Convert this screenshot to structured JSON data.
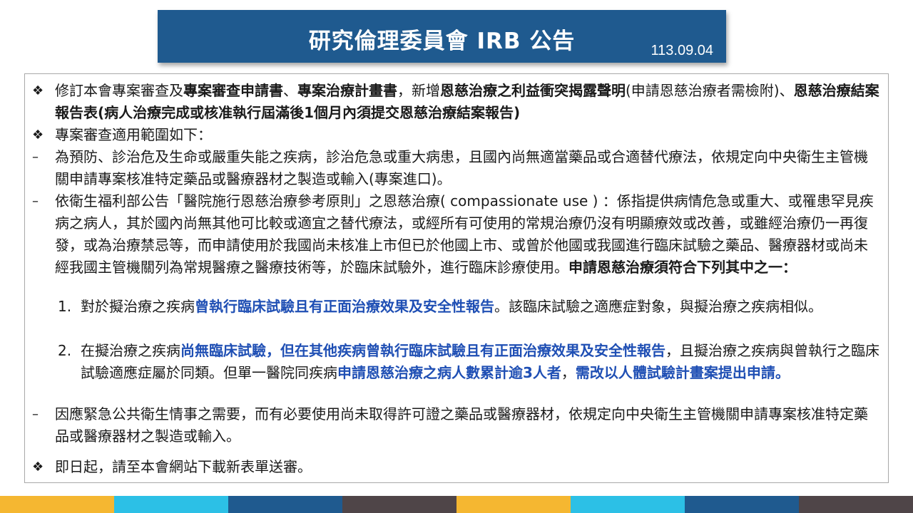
{
  "header": {
    "title": "研究倫理委員會 IRB 公告",
    "date": "113.09.04"
  },
  "colors": {
    "title_bg": "#1f5a8f",
    "highlight_blue": "#1f4fb4",
    "stripes": [
      "#f5b731",
      "#2cc0e6",
      "#1f5a8f",
      "#4f4548",
      "#f5b731",
      "#2cc0e6",
      "#1f5a8f",
      "#4f4548"
    ]
  },
  "icons": {
    "bullet": "diamond-bullet-icon"
  },
  "items": {
    "i1": {
      "marker": "❖",
      "p1": "修訂本會專案審查及",
      "b1": "專案審查申請書",
      "p2": "、",
      "b2": "專案治療計畫書",
      "p3": "，新增",
      "b3": "恩慈治療之利益衝突揭露聲明",
      "p4": "(申請恩慈治療者需檢附)、",
      "b4": "恩慈治療結案報告表(病人治療完成或核准執行屆滿後1個月內須提交恩慈治療結案報告)"
    },
    "i2": {
      "marker": "❖",
      "text": "專案審查適用範圍如下："
    },
    "i3": {
      "marker": "–",
      "text": "為預防、診治危及生命或嚴重失能之疾病，診治危急或重大病患，且國內尚無適當藥品或合適替代療法，依規定向中央衛生主管機關申請專案核准特定藥品或醫療器材之製造或輸入(專案進口)。"
    },
    "i4": {
      "marker": "–",
      "text": "依衛生福利部公告「醫院施行恩慈治療參考原則」之恩慈治療( compassionate use ) ：係指提供病情危急或重大、或罹患罕見疾病之病人，其於國內尚無其他可比較或適宜之替代療法，或經所有可使用的常規治療仍沒有明顯療效或改善，或雖經治療仍一再復發，或為治療禁忌等，而申請使用於我國尚未核准上市但已於他國上市、或曾於他國或我國進行臨床試驗之藥品、醫療器材或尚未經我國主管機關列為常規醫療之醫療技術等，於臨床試驗外，進行臨床診療使用。",
      "bold": "申請恩慈治療須符合下列其中之一："
    },
    "s1": {
      "marker": "1.",
      "p1": "對於擬治療之疾病",
      "blue1": "曾執行臨床試驗且有正面治療效果及安全性報告",
      "p2": "。該臨床試驗之適應症對象，與擬治療之疾病相似。"
    },
    "s2": {
      "marker": "2.",
      "p1": "在擬治療之疾病",
      "blue1": "尚無臨床試驗，但在其他疾病曾執行臨床試驗且有正面治療效果及安全性報告",
      "p2": "，且擬治療之疾病與曾執行之臨床試驗適應症屬於同類。但單一醫院同疾病",
      "blue2": "申請恩慈治療之病人數累計逾3人者",
      "p3": "，",
      "blue3": "需改以人體試驗計畫案提出申請。"
    },
    "i5": {
      "marker": "–",
      "text": "因應緊急公共衛生情事之需要，而有必要使用尚未取得許可證之藥品或醫療器材，依規定向中央衛生主管機關申請專案核准特定藥品或醫療器材之製造或輸入。"
    },
    "i6": {
      "marker": "❖",
      "text": "即日起，請至本會網站下載新表單送審。"
    }
  }
}
